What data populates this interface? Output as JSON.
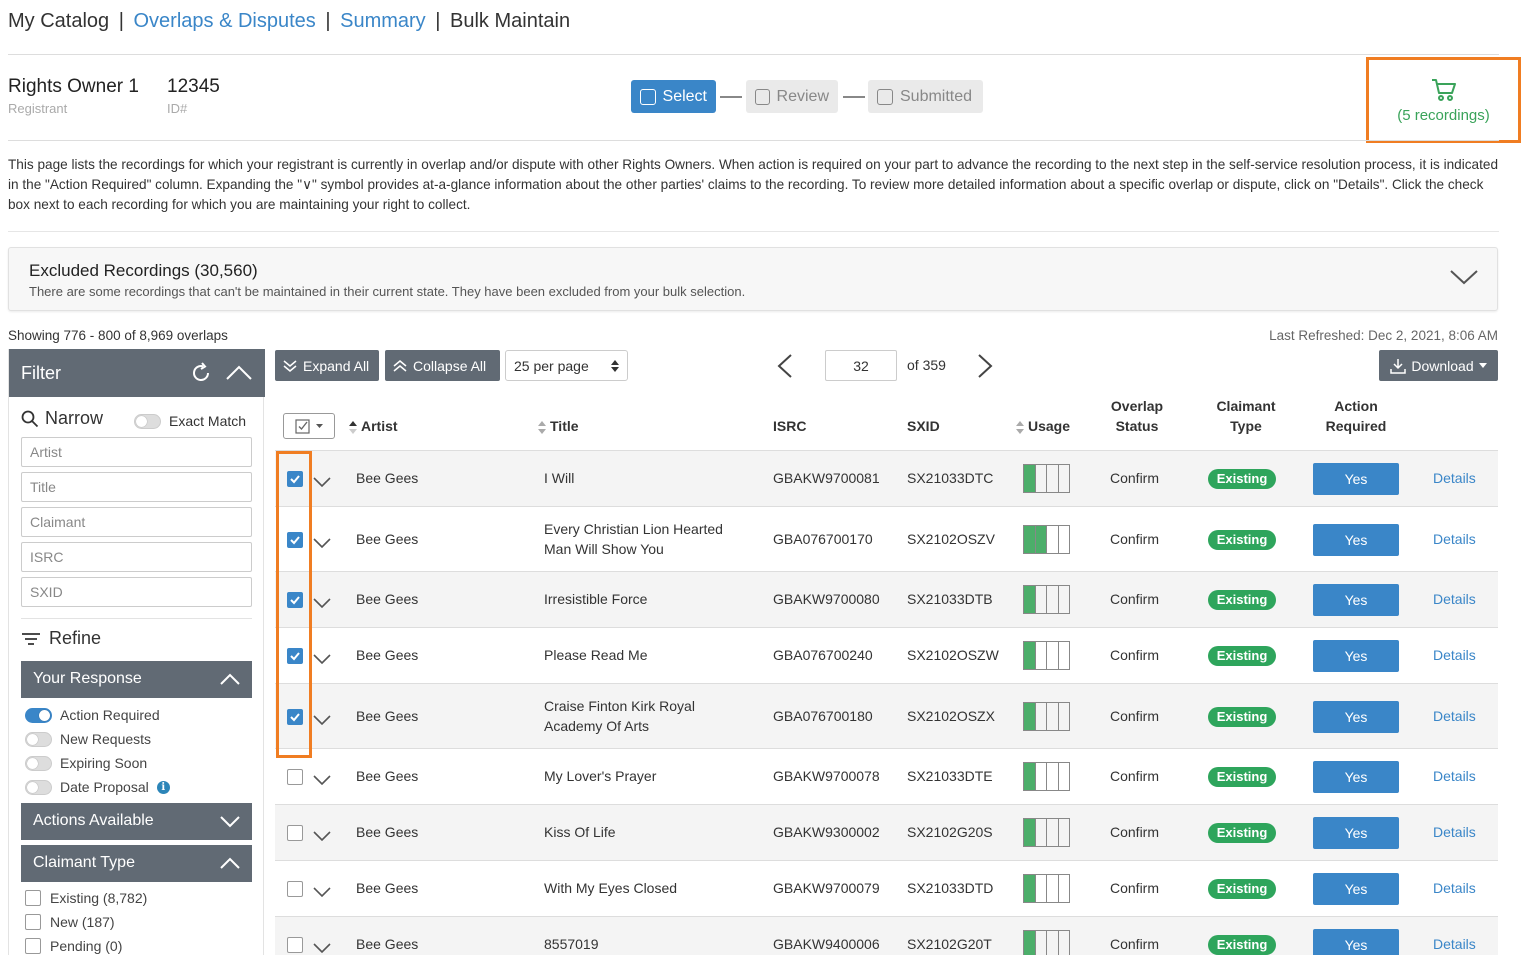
{
  "nav": {
    "items": [
      "My Catalog",
      "Overlaps & Disputes",
      "Summary",
      "Bulk Maintain"
    ],
    "separator": "|"
  },
  "registrant": {
    "name": "Rights Owner 1",
    "name_label": "Registrant",
    "id": "12345",
    "id_label": "ID#"
  },
  "steps": [
    "Select",
    "Review",
    "Submitted"
  ],
  "active_step": "Select",
  "cart": {
    "label": "(5 recordings)",
    "icon": "cart-icon",
    "color": "#3aa35a",
    "highlight_color": "#f07d22"
  },
  "description": "This page lists the recordings for which your registrant is currently in overlap and/or dispute with other Rights Owners. When action is required on your part to advance the recording to the next step in the self-service resolution process, it is indicated in the \"Action Required\" column. Expanding the \"∨\" symbol provides at-a-glance information about the other parties' claims to the recording. To review more detailed information about a specific overlap or dispute, click on \"Details\". Click the check box next to each recording for which you are maintaining your right to collect.",
  "excluded": {
    "title": "Excluded Recordings (30,560)",
    "subtitle": "There are some recordings that can't be maintained in their current state. They have been excluded from your bulk selection."
  },
  "showing": "Showing 776 - 800 of 8,969 overlaps",
  "last_refreshed": "Last Refreshed: Dec 2, 2021, 8:06 AM",
  "filter": {
    "title": "Filter",
    "narrow_label": "Narrow",
    "exact_match_label": "Exact Match",
    "placeholders": {
      "artist": "Artist",
      "title": "Title",
      "claimant": "Claimant",
      "isrc": "ISRC",
      "sxid": "SXID"
    },
    "refine_label": "Refine",
    "your_response": {
      "title": "Your Response",
      "toggles": [
        {
          "label": "Action Required",
          "on": true
        },
        {
          "label": "New Requests",
          "on": false
        },
        {
          "label": "Expiring Soon",
          "on": false
        },
        {
          "label": "Date Proposal",
          "on": false
        }
      ]
    },
    "actions_available": "Actions Available",
    "claimant_type": {
      "title": "Claimant Type",
      "options": [
        "Existing (8,782)",
        "New (187)",
        "Pending (0)"
      ]
    }
  },
  "toolbar": {
    "expand_all": "Expand All",
    "collapse_all": "Collapse All",
    "per_page": "25 per page",
    "page": "32",
    "of_pages": "of 359",
    "download": "Download"
  },
  "columns": {
    "artist": "Artist",
    "title": "Title",
    "isrc": "ISRC",
    "sxid": "SXID",
    "usage": "Usage",
    "overlap_status_1": "Overlap",
    "overlap_status_2": "Status",
    "claimant_type_1": "Claimant",
    "claimant_type_2": "Type",
    "action_required_1": "Action",
    "action_required_2": "Required"
  },
  "rows": [
    {
      "checked": true,
      "artist": "Bee Gees",
      "title_1": "I Will",
      "title_2": "",
      "isrc": "GBAKW9700081",
      "sxid": "SX21033DTC",
      "usage": 1,
      "status": "Confirm",
      "claimant": "Existing",
      "action": "Yes",
      "details": "Details"
    },
    {
      "checked": true,
      "artist": "Bee Gees",
      "title_1": "Every Christian Lion Hearted",
      "title_2": "Man Will Show You",
      "isrc": "GBA076700170",
      "sxid": "SX2102OSZV",
      "usage": 2,
      "status": "Confirm",
      "claimant": "Existing",
      "action": "Yes",
      "details": "Details"
    },
    {
      "checked": true,
      "artist": "Bee Gees",
      "title_1": "Irresistible Force",
      "title_2": "",
      "isrc": "GBAKW9700080",
      "sxid": "SX21033DTB",
      "usage": 1,
      "status": "Confirm",
      "claimant": "Existing",
      "action": "Yes",
      "details": "Details"
    },
    {
      "checked": true,
      "artist": "Bee Gees",
      "title_1": "Please Read Me",
      "title_2": "",
      "isrc": "GBA076700240",
      "sxid": "SX2102OSZW",
      "usage": 1,
      "status": "Confirm",
      "claimant": "Existing",
      "action": "Yes",
      "details": "Details"
    },
    {
      "checked": true,
      "artist": "Bee Gees",
      "title_1": "Craise Finton Kirk Royal",
      "title_2": "Academy Of Arts",
      "isrc": "GBA076700180",
      "sxid": "SX2102OSZX",
      "usage": 1,
      "status": "Confirm",
      "claimant": "Existing",
      "action": "Yes",
      "details": "Details"
    },
    {
      "checked": false,
      "artist": "Bee Gees",
      "title_1": "My Lover's Prayer",
      "title_2": "",
      "isrc": "GBAKW9700078",
      "sxid": "SX21033DTE",
      "usage": 1,
      "status": "Confirm",
      "claimant": "Existing",
      "action": "Yes",
      "details": "Details"
    },
    {
      "checked": false,
      "artist": "Bee Gees",
      "title_1": "Kiss Of Life",
      "title_2": "",
      "isrc": "GBAKW9300002",
      "sxid": "SX2102G20S",
      "usage": 1,
      "status": "Confirm",
      "claimant": "Existing",
      "action": "Yes",
      "details": "Details"
    },
    {
      "checked": false,
      "artist": "Bee Gees",
      "title_1": "With My Eyes Closed",
      "title_2": "",
      "isrc": "GBAKW9700079",
      "sxid": "SX21033DTD",
      "usage": 1,
      "status": "Confirm",
      "claimant": "Existing",
      "action": "Yes",
      "details": "Details"
    },
    {
      "checked": false,
      "artist": "Bee Gees",
      "title_1": "8557019",
      "title_2": "",
      "isrc": "GBAKW9400006",
      "sxid": "SX2102G20T",
      "usage": 1,
      "status": "Confirm",
      "claimant": "Existing",
      "action": "Yes",
      "details": "Details"
    }
  ],
  "colors": {
    "accent": "#3a86c8",
    "dark_header": "#616a74",
    "badge_green": "#2ea55c",
    "highlight": "#f07d22"
  }
}
